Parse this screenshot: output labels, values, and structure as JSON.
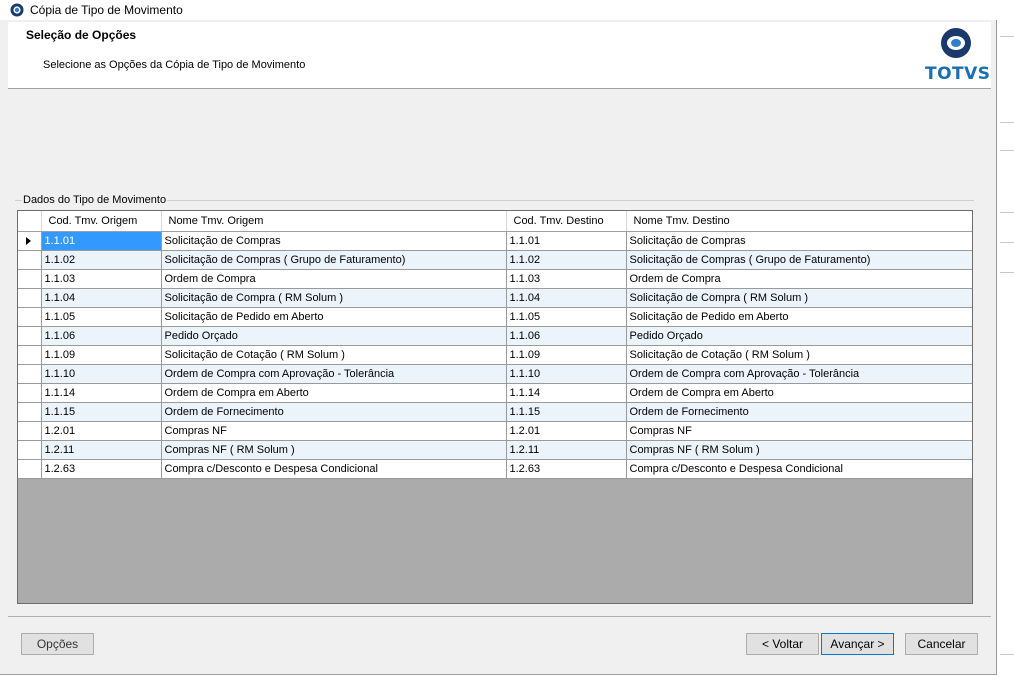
{
  "window": {
    "title": "Cópia de Tipo de Movimento"
  },
  "header": {
    "step_title": "Seleção de Opções",
    "step_description": "Selecione as Opções da Cópia de Tipo de Movimento",
    "logo_text": "TOTVS"
  },
  "group": {
    "label": "Dados do Tipo de Movimento"
  },
  "grid": {
    "columns": {
      "cod_origem": "Cod. Tmv. Origem",
      "nome_origem": "Nome Tmv. Origem",
      "cod_destino": "Cod. Tmv. Destino",
      "nome_destino": "Nome Tmv. Destino"
    },
    "rows": [
      {
        "cod_origem": "1.1.01",
        "nome_origem": "Solicitação de Compras",
        "cod_destino": "1.1.01",
        "nome_destino": "Solicitação de Compras"
      },
      {
        "cod_origem": "1.1.02",
        "nome_origem": "Solicitação de Compras ( Grupo de Faturamento)",
        "cod_destino": "1.1.02",
        "nome_destino": "Solicitação de Compras ( Grupo de Faturamento)"
      },
      {
        "cod_origem": "1.1.03",
        "nome_origem": "Ordem de Compra",
        "cod_destino": "1.1.03",
        "nome_destino": "Ordem de Compra"
      },
      {
        "cod_origem": "1.1.04",
        "nome_origem": "Solicitação de Compra  ( RM Solum )",
        "cod_destino": "1.1.04",
        "nome_destino": "Solicitação de Compra  ( RM Solum )"
      },
      {
        "cod_origem": "1.1.05",
        "nome_origem": "Solicitação de Pedido em Aberto",
        "cod_destino": "1.1.05",
        "nome_destino": "Solicitação de Pedido em Aberto"
      },
      {
        "cod_origem": "1.1.06",
        "nome_origem": "Pedido Orçado",
        "cod_destino": "1.1.06",
        "nome_destino": "Pedido Orçado"
      },
      {
        "cod_origem": "1.1.09",
        "nome_origem": "Solicitação de Cotação  ( RM Solum )",
        "cod_destino": "1.1.09",
        "nome_destino": "Solicitação de Cotação  ( RM Solum )"
      },
      {
        "cod_origem": "1.1.10",
        "nome_origem": "Ordem de Compra com Aprovação - Tolerância",
        "cod_destino": "1.1.10",
        "nome_destino": "Ordem de Compra com Aprovação - Tolerância"
      },
      {
        "cod_origem": "1.1.14",
        "nome_origem": "Ordem de Compra em Aberto",
        "cod_destino": "1.1.14",
        "nome_destino": "Ordem de Compra em Aberto"
      },
      {
        "cod_origem": "1.1.15",
        "nome_origem": "Ordem de Fornecimento",
        "cod_destino": "1.1.15",
        "nome_destino": "Ordem de Fornecimento"
      },
      {
        "cod_origem": "1.2.01",
        "nome_origem": "Compras NF",
        "cod_destino": "1.2.01",
        "nome_destino": "Compras NF"
      },
      {
        "cod_origem": "1.2.11",
        "nome_origem": "Compras NF  ( RM Solum )",
        "cod_destino": "1.2.11",
        "nome_destino": "Compras NF  ( RM Solum )"
      },
      {
        "cod_origem": "1.2.63",
        "nome_origem": "Compra c/Desconto e Despesa Condicional",
        "cod_destino": "1.2.63",
        "nome_destino": "Compra c/Desconto e Despesa Condicional"
      }
    ]
  },
  "footer": {
    "options_label": "Opções",
    "back_label": "< Voltar",
    "next_label": "Avançar >",
    "cancel_label": "Cancelar"
  },
  "colors": {
    "selection": "#3399ff",
    "alt_row": "#ecf4fb",
    "logo": "#1a6fb1",
    "grid_empty": "#ababab"
  }
}
